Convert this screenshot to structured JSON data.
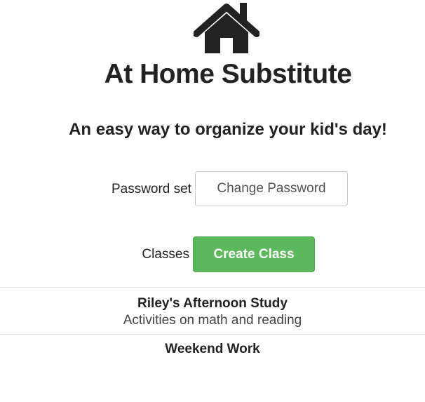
{
  "header": {
    "logo_icon": "house-icon",
    "title": "At Home Substitute",
    "tagline": "An easy way to organize your kid's day!"
  },
  "password": {
    "label": "Password set",
    "button_label": "Change Password"
  },
  "classes": {
    "label": "Classes",
    "create_button_label": "Create Class",
    "items": [
      {
        "name": "Riley's Afternoon Study",
        "description": "Activities on math and reading"
      },
      {
        "name": "Weekend Work",
        "description": ""
      }
    ]
  },
  "colors": {
    "primary_text": "#222222",
    "create_button": "#5cb85c",
    "divider": "#dddddd"
  }
}
